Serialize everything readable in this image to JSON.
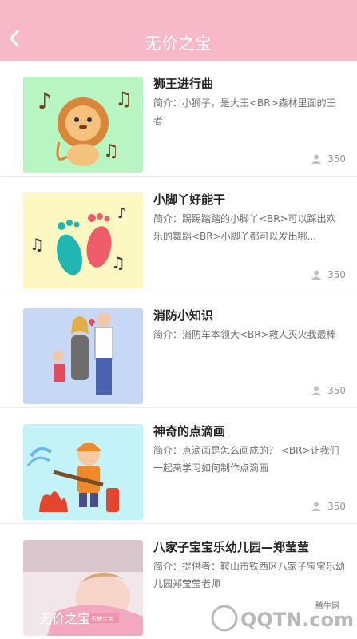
{
  "header": {
    "title": "无价之宝",
    "background": "#f7b9c8"
  },
  "items": [
    {
      "title": "狮王进行曲",
      "description": "简介：小狮子，是大王<BR>森林里面的王者",
      "views": "350",
      "thumb_icon": "lion-image"
    },
    {
      "title": "小脚丫好能干",
      "description": "简介：踢踢踏踏的小脚丫<BR>可以踩出欢乐的舞蹈<BR>小脚丫都可以发出哪...",
      "views": "350",
      "thumb_icon": "footprints-image"
    },
    {
      "title": "消防小知识",
      "description": "简介：消防车本领大<BR>救人灭火我最棒",
      "views": "350",
      "thumb_icon": "family-image"
    },
    {
      "title": "神奇的点滴画",
      "description": "简介：点滴画是怎么画成的？ <BR>让我们一起来学习如何制作点滴画",
      "views": "350",
      "thumb_icon": "firefighter-image"
    },
    {
      "title": "八家子宝宝乐幼儿园—郑莹莹",
      "description": "简介：提供者：鞍山市铁西区八家子宝宝乐幼儿园郑莹莹老师",
      "views": "",
      "thumb_icon": "sleeping-baby-image",
      "thumb_text": "无价之宝",
      "thumb_sub": "天使宝宝"
    }
  ],
  "watermark": {
    "site": "QQTN.com",
    "label": "腾牛网"
  }
}
